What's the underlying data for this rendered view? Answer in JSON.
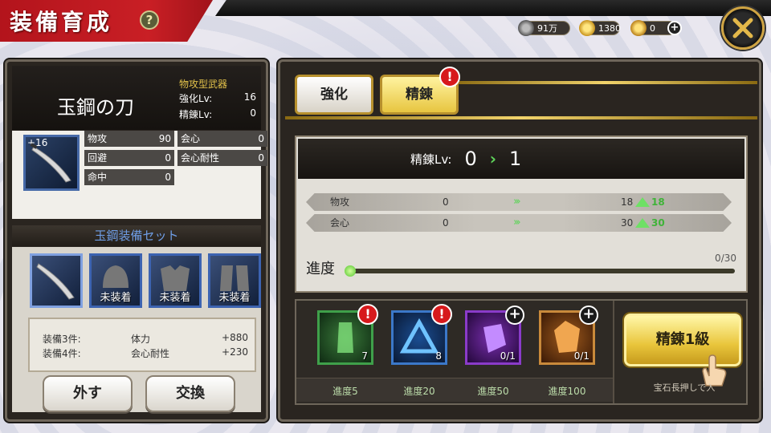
{
  "header": {
    "title": "装備育成",
    "help": "?"
  },
  "resources": {
    "coin": "91万",
    "gold": "1380",
    "gem": "0",
    "add": "+"
  },
  "weapon": {
    "name": "玉鋼の刀",
    "type": "物攻型武器",
    "enhance_label": "強化Lv:",
    "enhance_value": "16",
    "refine_label": "精錬Lv:",
    "refine_value": "0",
    "plus": "+16",
    "stats": {
      "atk_label": "物攻",
      "atk_value": "90",
      "crit_label": "会心",
      "crit_value": "0",
      "eva_label": "回避",
      "eva_value": "0",
      "critres_label": "会心耐性",
      "critres_value": "0",
      "hit_label": "命中",
      "hit_value": "0"
    }
  },
  "set": {
    "title": "玉鋼装備セット",
    "items": [
      {
        "label": ""
      },
      {
        "label": "未装着"
      },
      {
        "label": "未装着"
      },
      {
        "label": "未装着"
      }
    ],
    "bonuses": [
      {
        "count": "装備3件:",
        "stat": "体力",
        "value": "+880"
      },
      {
        "count": "装備4件:",
        "stat": "会心耐性",
        "value": "+230"
      }
    ],
    "remove_button": "外す",
    "swap_button": "交換"
  },
  "tabs": [
    {
      "label": "強化",
      "active": false
    },
    {
      "label": "精錬",
      "active": true
    }
  ],
  "refine": {
    "level_label": "精錬Lv:",
    "from_level": "0",
    "to_level": "1",
    "rows": [
      {
        "name": "物攻",
        "current": "0",
        "after": "18",
        "gain": "18"
      },
      {
        "name": "会心",
        "current": "0",
        "after": "30",
        "gain": "30"
      }
    ],
    "progress_label": "進度",
    "progress_current": "0",
    "progress_max": "/30",
    "progress_fraction": 0
  },
  "materials": [
    {
      "count": "7",
      "caption": "進度5",
      "badge": "!",
      "color": "green"
    },
    {
      "count": "8",
      "caption": "進度20",
      "badge": "!",
      "color": "blue"
    },
    {
      "count": "0/1",
      "caption": "進度50",
      "badge": "+",
      "color": "purple"
    },
    {
      "count": "0/1",
      "caption": "進度100",
      "badge": "+",
      "color": "orange"
    }
  ],
  "refine_button": "精錬1級",
  "hint": "宝石長押しで入"
}
